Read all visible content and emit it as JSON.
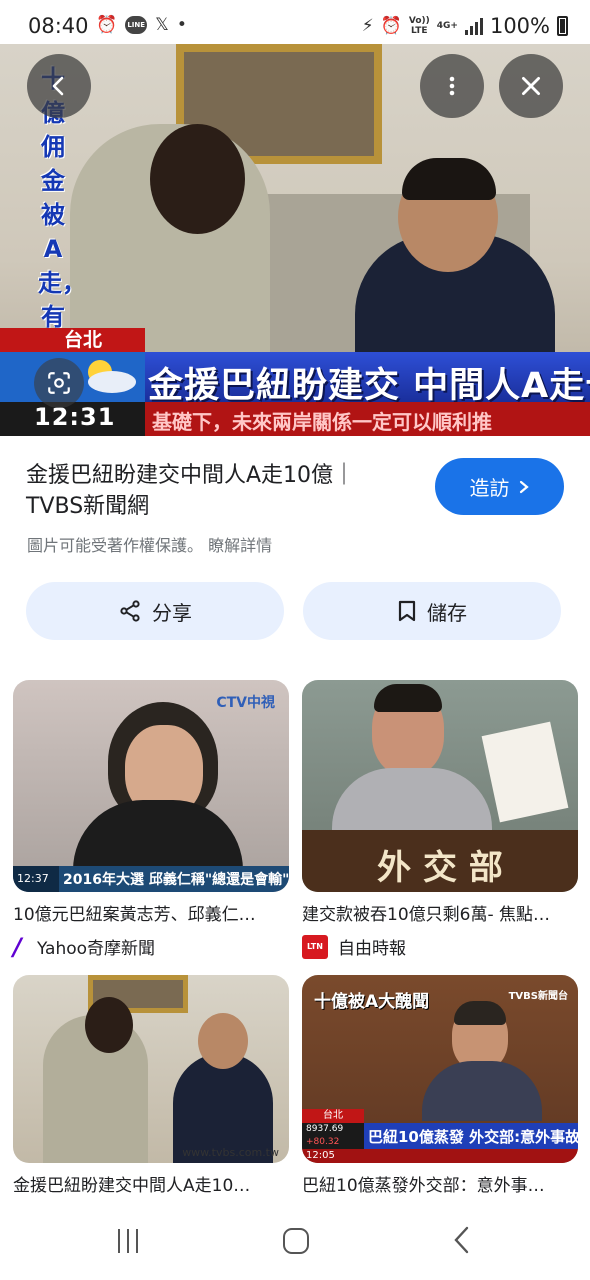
{
  "status_bar": {
    "time": "08:40",
    "network_small_top": "Vo))",
    "network_small_bottom": "LTE",
    "network_4g": "4G+",
    "line_label": "LINE",
    "x_label": "𝕏",
    "dot": "•",
    "battery_text": "100%"
  },
  "hero": {
    "vertical_text": "十億佣金被A走，有沒",
    "location_tag": "台北",
    "headline": "金援巴紐盼建交 中間人A走十億",
    "clock": "12:31",
    "ticker": "基礎下，未來兩岸關係一定可以順利推"
  },
  "result": {
    "title": "金援巴紐盼建交中間人A走10億｜TVBS新聞網",
    "copyright_notice": "圖片可能受著作權保護。",
    "learn_more": "瞭解詳情",
    "visit_label": "造訪"
  },
  "actions": {
    "share_label": "分享",
    "save_label": "儲存"
  },
  "related": [
    {
      "title": "10億元巴紐案黃志芳、邱義仁…",
      "source": "Yahoo奇摩新聞",
      "watermark": "CTV中視",
      "caption": "2016年大選 邱義仁稱\"總還是會輸\"",
      "clock": "12:37"
    },
    {
      "title": "建交款被吞10億只剩6萬- 焦點…",
      "source": "自由時報",
      "sign_text": "外 交 部",
      "ltn_icon_text": "LTN"
    },
    {
      "title": "金援巴紐盼建交中間人A走10…",
      "source": "",
      "watermark": "www.tvbs.com.tw"
    },
    {
      "title": "巴紐10億蒸發外交部：意外事…",
      "source": "",
      "top_label": "十億被A大醜聞",
      "watermark": "TVBS新聞台",
      "headline": "巴紐10億蒸發 外交部:意外事故",
      "location_tag": "台北",
      "clock": "12:05",
      "index_value": "8937.69",
      "index_change": "+80.32"
    }
  ]
}
